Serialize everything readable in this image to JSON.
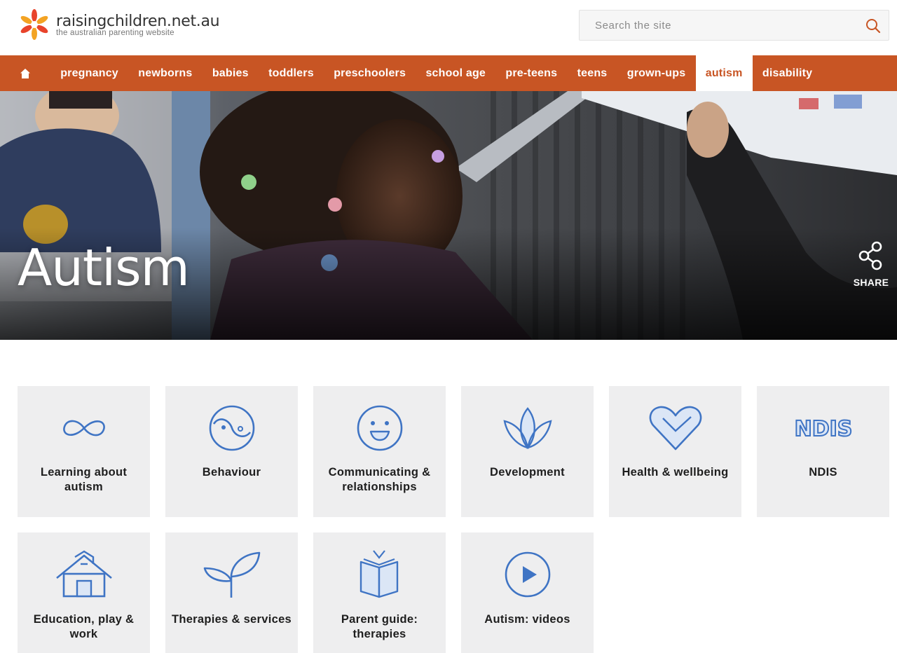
{
  "site": {
    "name": "raisingchildren.net.au",
    "tagline": "the australian parenting website"
  },
  "search": {
    "placeholder": "Search the site"
  },
  "nav": {
    "items": [
      {
        "label": "pregnancy"
      },
      {
        "label": "newborns"
      },
      {
        "label": "babies"
      },
      {
        "label": "toddlers"
      },
      {
        "label": "preschoolers"
      },
      {
        "label": "school age"
      },
      {
        "label": "pre-teens"
      },
      {
        "label": "teens"
      },
      {
        "label": "grown-ups"
      },
      {
        "label": "autism",
        "active": true
      },
      {
        "label": "disability"
      }
    ]
  },
  "hero": {
    "title": "Autism",
    "share_label": "SHARE"
  },
  "tiles": [
    {
      "label": "Learning about autism",
      "icon": "infinity-icon"
    },
    {
      "label": "Behaviour",
      "icon": "yin-yang-icon"
    },
    {
      "label": "Communicating & relationships",
      "icon": "smiley-face-icon"
    },
    {
      "label": "Development",
      "icon": "lotus-icon"
    },
    {
      "label": "Health & wellbeing",
      "icon": "heart-icon"
    },
    {
      "label": "NDIS",
      "icon": "ndis-logo-icon",
      "icon_text": "NDIS"
    },
    {
      "label": "Education, play & work",
      "icon": "school-house-icon"
    },
    {
      "label": "Therapies & services",
      "icon": "sprout-icon"
    },
    {
      "label": "Parent guide: therapies",
      "icon": "open-book-icon"
    },
    {
      "label": "Autism: videos",
      "icon": "play-button-icon"
    }
  ],
  "colors": {
    "brand_orange": "#c85524",
    "icon_blue": "#3f74c4",
    "tile_bg": "#eeeeef"
  }
}
